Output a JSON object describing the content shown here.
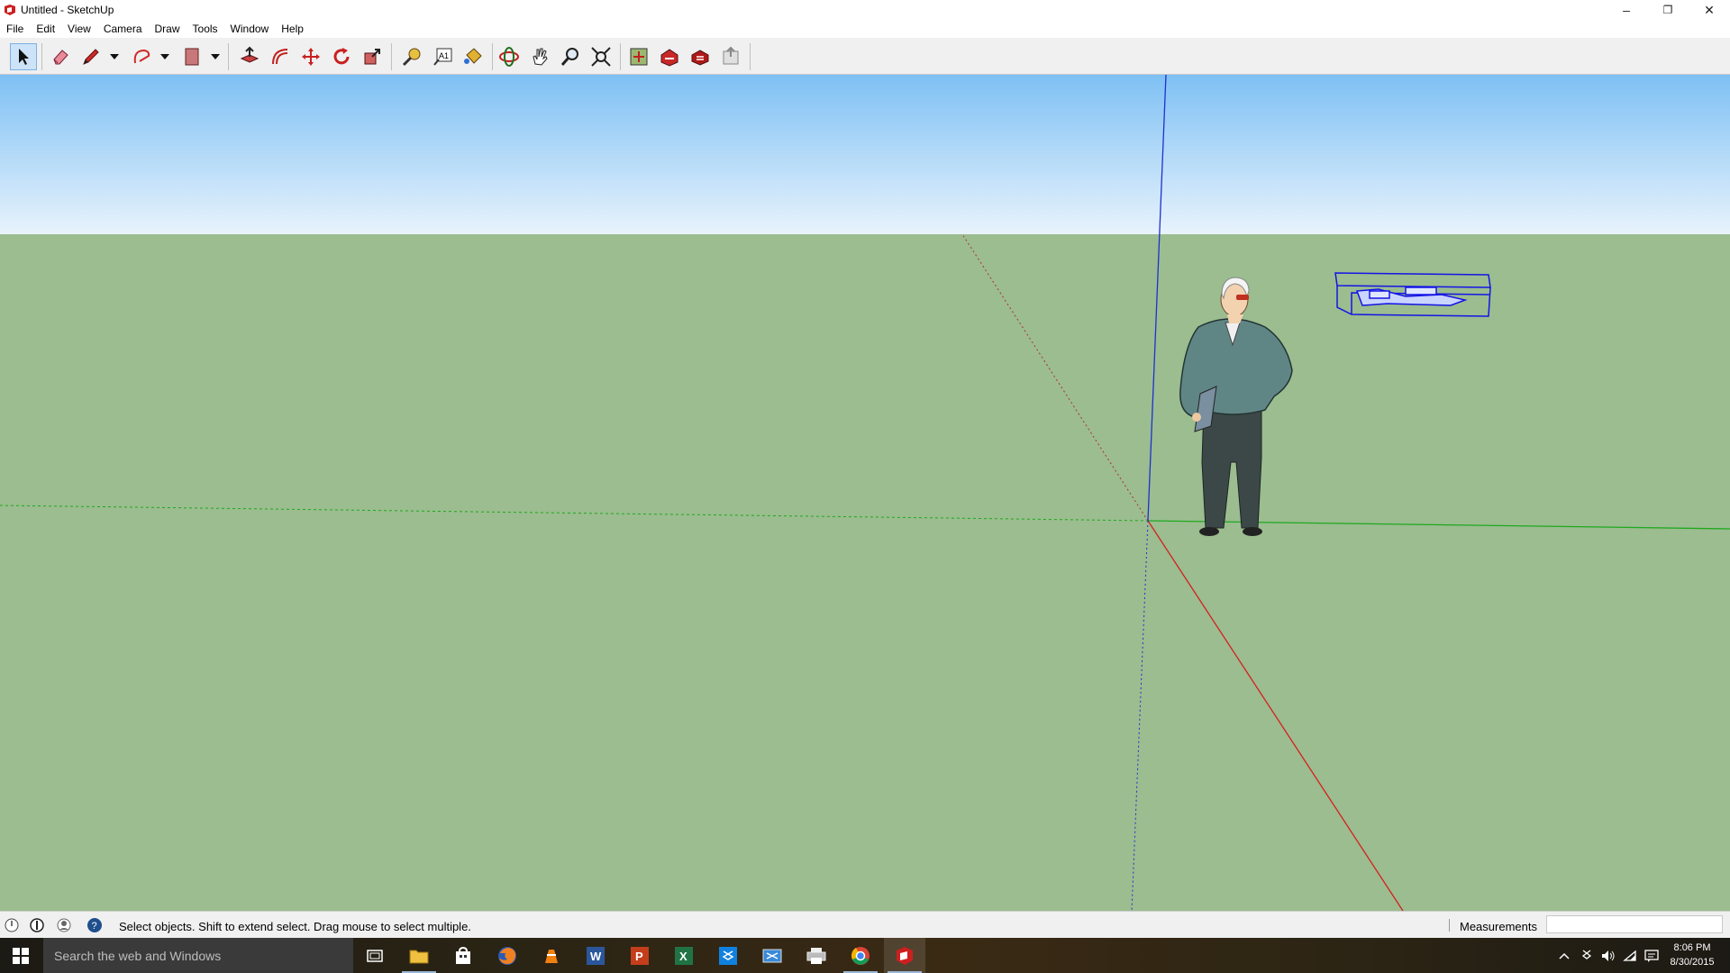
{
  "window": {
    "title": "Untitled - SketchUp"
  },
  "window_controls": {
    "minimize": "–",
    "maximize": "❐",
    "close": "✕"
  },
  "menu": [
    "File",
    "Edit",
    "View",
    "Camera",
    "Draw",
    "Tools",
    "Window",
    "Help"
  ],
  "toolbar": {
    "tools": [
      {
        "name": "select-tool",
        "icon": "arrow-cursor-icon",
        "active": true
      },
      {
        "name": "eraser-tool",
        "icon": "eraser-icon"
      },
      {
        "name": "line-tool",
        "icon": "pencil-icon"
      },
      {
        "name": "line-tool-dropdown",
        "icon": "dropdown-arrow-icon"
      },
      {
        "name": "arc-tool",
        "icon": "arc-icon"
      },
      {
        "name": "arc-tool-dropdown",
        "icon": "dropdown-arrow-icon"
      },
      {
        "name": "rectangle-tool",
        "icon": "rectangle-icon"
      },
      {
        "name": "rectangle-tool-dropdown",
        "icon": "dropdown-arrow-icon"
      },
      {
        "name": "push-pull-tool",
        "icon": "push-pull-icon"
      },
      {
        "name": "offset-tool",
        "icon": "offset-icon"
      },
      {
        "name": "move-tool",
        "icon": "move-icon"
      },
      {
        "name": "rotate-tool",
        "icon": "rotate-icon"
      },
      {
        "name": "scale-tool",
        "icon": "scale-icon"
      },
      {
        "name": "tape-measure-tool",
        "icon": "tape-measure-icon"
      },
      {
        "name": "text-tool",
        "icon": "text-icon"
      },
      {
        "name": "paint-bucket-tool",
        "icon": "paint-bucket-icon"
      },
      {
        "name": "orbit-tool",
        "icon": "orbit-icon"
      },
      {
        "name": "pan-tool",
        "icon": "pan-hand-icon"
      },
      {
        "name": "zoom-tool",
        "icon": "zoom-icon"
      },
      {
        "name": "zoom-extents-tool",
        "icon": "zoom-extents-icon"
      },
      {
        "name": "add-location-tool",
        "icon": "add-location-icon"
      },
      {
        "name": "3d-warehouse-tool",
        "icon": "warehouse-icon"
      },
      {
        "name": "extension-warehouse-tool",
        "icon": "extension-warehouse-icon"
      },
      {
        "name": "share-model-tool",
        "icon": "share-model-icon"
      }
    ],
    "text_tool_glyph": "A1"
  },
  "colors": {
    "sky_top": "#7ec0f4",
    "sky_bottom": "#e8f3fc",
    "ground": "#9bbd8f",
    "axis_red": "#d42020",
    "axis_green": "#1fa81f",
    "axis_blue": "#2030d0",
    "selection_blue": "#1414e6",
    "sketchup_red": "#cc1f1f"
  },
  "scene": {
    "figure": "person-model",
    "selected_component": "selected-component"
  },
  "status": {
    "message": "Select objects. Shift to extend select. Drag mouse to select multiple.",
    "measurements_label": "Measurements",
    "measurements_value": ""
  },
  "taskbar": {
    "search_placeholder": "Search the web and Windows",
    "apps": [
      {
        "name": "task-view",
        "icon": "task-view-icon"
      },
      {
        "name": "file-explorer",
        "icon": "folder-icon"
      },
      {
        "name": "store",
        "icon": "store-icon"
      },
      {
        "name": "firefox",
        "icon": "firefox-icon"
      },
      {
        "name": "vlc",
        "icon": "vlc-icon"
      },
      {
        "name": "word",
        "icon": "word-icon",
        "glyph": "W"
      },
      {
        "name": "powerpoint",
        "icon": "powerpoint-icon",
        "glyph": "P"
      },
      {
        "name": "excel",
        "icon": "excel-icon",
        "glyph": "X"
      },
      {
        "name": "dropbox",
        "icon": "dropbox-icon"
      },
      {
        "name": "snipping-tool",
        "icon": "snipping-icon"
      },
      {
        "name": "printer",
        "icon": "printer-icon"
      },
      {
        "name": "chrome",
        "icon": "chrome-icon"
      },
      {
        "name": "sketchup",
        "icon": "sketchup-icon"
      }
    ],
    "clock_time": "8:06 PM",
    "clock_date": "8/30/2015"
  }
}
